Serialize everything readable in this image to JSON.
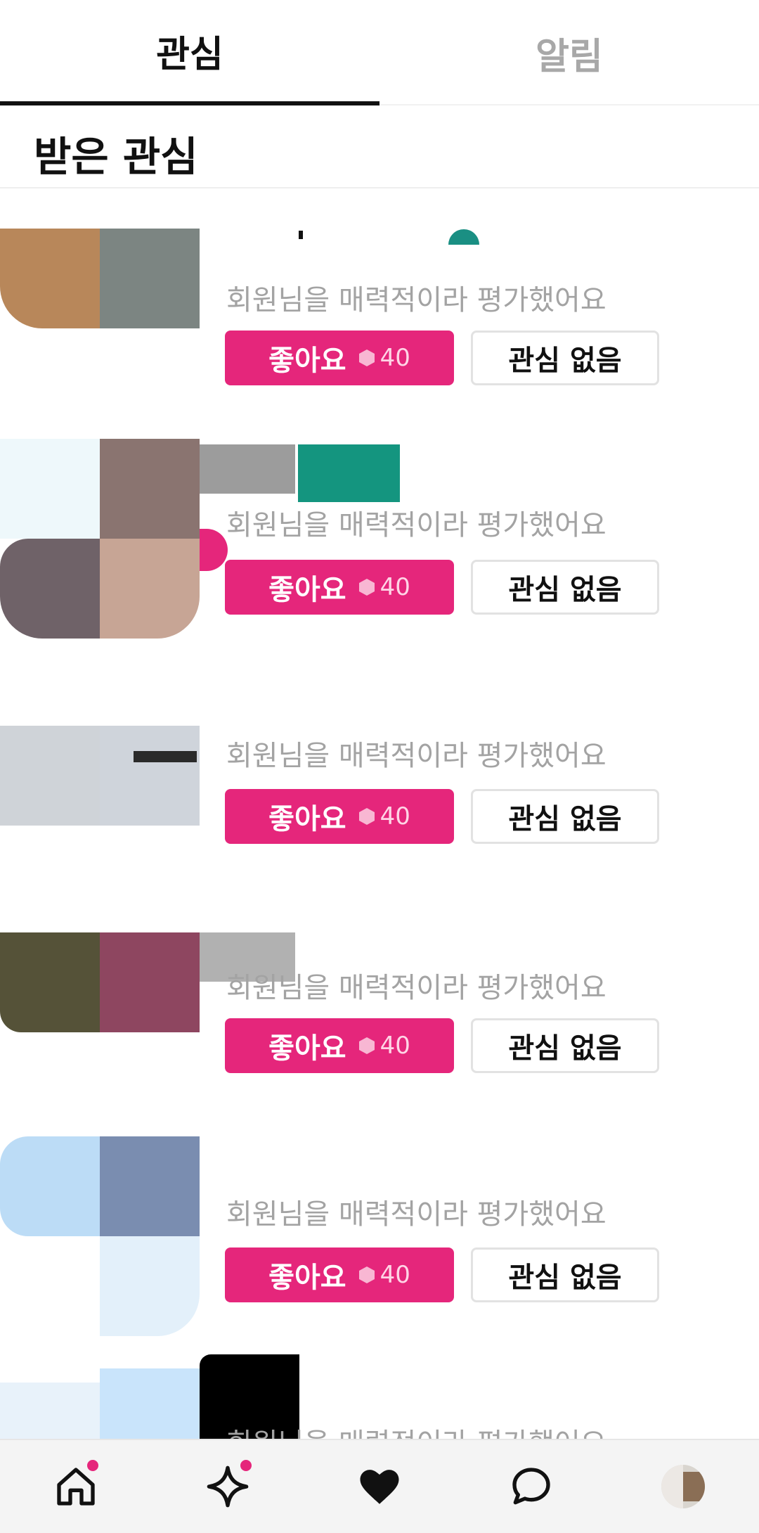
{
  "tabs": [
    {
      "label": "관심",
      "active": true
    },
    {
      "label": "알림",
      "active": false
    }
  ],
  "section_title": "받은 관심",
  "colors": {
    "accent": "#e5267b",
    "inactive_tab": "#a8a8a8",
    "secondary_text": "#a3a3a3"
  },
  "items": [
    {
      "message": "회원님을 매력적이라 평가했어요",
      "like_label": "좋아요",
      "like_cost": "40",
      "pass_label": "관심 없음"
    },
    {
      "message": "회원님을 매력적이라 평가했어요",
      "like_label": "좋아요",
      "like_cost": "40",
      "pass_label": "관심 없음"
    },
    {
      "message": "회원님을 매력적이라 평가했어요",
      "like_label": "좋아요",
      "like_cost": "40",
      "pass_label": "관심 없음"
    },
    {
      "message": "회원님을 매력적이라 평가했어요",
      "like_label": "좋아요",
      "like_cost": "40",
      "pass_label": "관심 없음"
    },
    {
      "message": "회원님을 매력적이라 평가했어요",
      "like_label": "좋아요",
      "like_cost": "40",
      "pass_label": "관심 없음"
    },
    {
      "message": "회원님을 매력적이라 평가했어요"
    }
  ],
  "bottom_nav": [
    {
      "icon": "home-icon",
      "badge": true
    },
    {
      "icon": "sparkle-icon",
      "badge": true
    },
    {
      "icon": "heart-icon",
      "badge": false
    },
    {
      "icon": "chat-bubble-icon",
      "badge": false
    },
    {
      "icon": "profile-avatar",
      "badge": false
    }
  ]
}
